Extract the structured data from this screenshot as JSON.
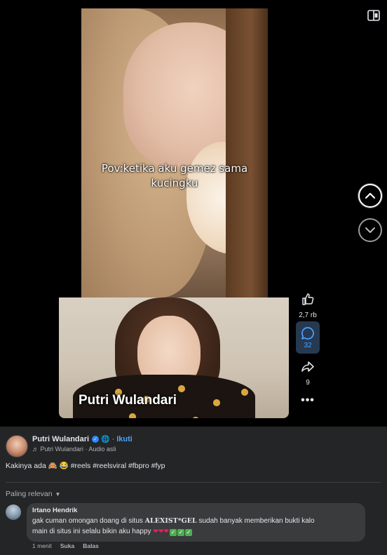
{
  "video": {
    "caption_line1": "Pov:ketika aku gemez sama",
    "caption_line2": "kucingku",
    "overlay_name": "Putri Wulandari"
  },
  "actions": {
    "like_count": "2,7 rb",
    "comment_count": "32",
    "share_count": "9",
    "more_label": "•••"
  },
  "post": {
    "author": "Putri Wulandari",
    "follow_label": "Ikuti",
    "audio": "Putri Wulandari · Audio asli",
    "text": "Kakinya ada 🙈 😂   #reels #reelsviral #fbpro #fyp"
  },
  "comments": {
    "sort_label": "Paling relevan",
    "items": [
      {
        "name": "Irtano Hendrik",
        "text_before": "gak cuman omongan doang di situs ",
        "brand": "ALEXIST*GEL",
        "text_after": " sudah banyak memberikan bukti kalo",
        "text_line2": "main di situs ini selalu bikin aku happy ",
        "time": "1 menit",
        "like_label": "Suka",
        "reply_label": "Balas"
      }
    ]
  },
  "colors": {
    "panel_bg": "#242526",
    "accent_blue": "#4aa3ff",
    "comment_bubble": "#3a3b3c"
  }
}
